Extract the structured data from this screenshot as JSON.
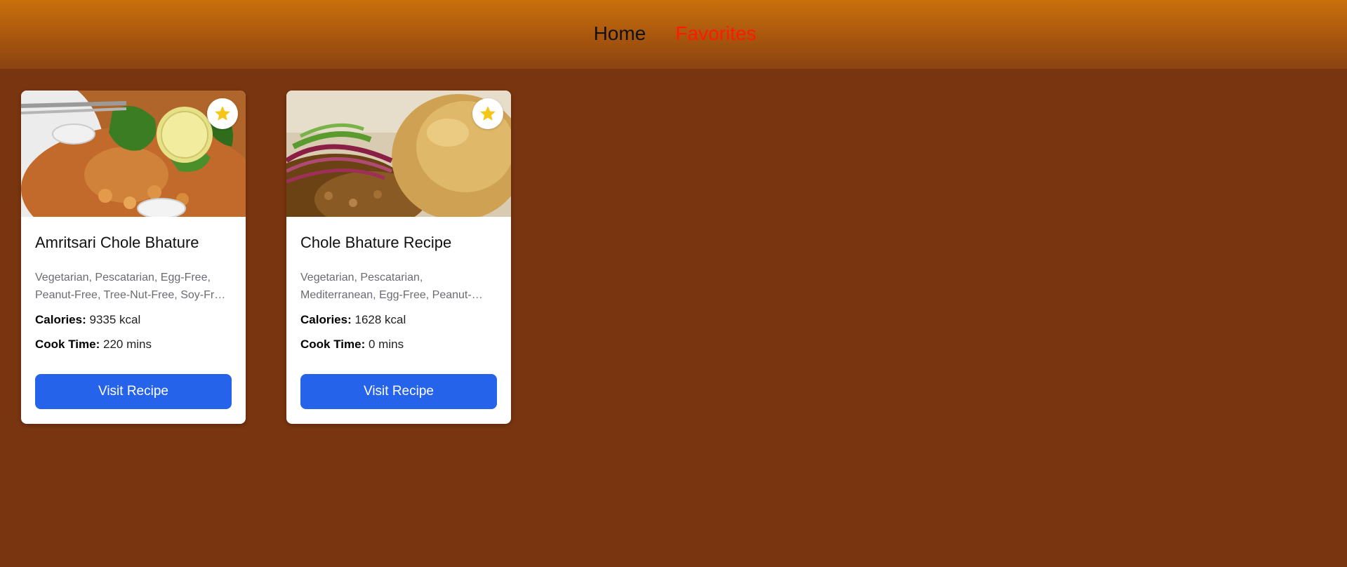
{
  "nav": {
    "home_label": "Home",
    "favorites_label": "Favorites",
    "active": "favorites"
  },
  "colors": {
    "background": "#783510",
    "button": "#2563eb",
    "active_link": "#ff1a00",
    "star": "#f5c518"
  },
  "recipes": [
    {
      "title": "Amritsari Chole Bhature",
      "tags": "Vegetarian, Pescatarian, Egg-Free, Peanut-Free, Tree-Nut-Free, Soy-Free, Fish-Free, Shellfish-Free, Pork-Free, Red-Meat-Free, Crustacean-Free, Celery-Free, Mustard-Free, Sesame-Free, Lupine-Free, Mollusk-Free, Alcohol-Free, Sulfite-Free",
      "calories_label": "Calories:",
      "calories_value": "9335 kcal",
      "cook_time_label": "Cook Time:",
      "cook_time_value": "220 mins",
      "button_label": "Visit Recipe",
      "favorite_icon": "star-icon",
      "image": "chole-with-lemon-and-cilantro"
    },
    {
      "title": "Chole Bhature Recipe",
      "tags": "Vegetarian, Pescatarian, Mediterranean, Egg-Free, Peanut-Free, Tree-Nut-Free, Soy-Free, Fish-Free, Shellfish-Free, Pork-Free, Red-Meat-Free, Crustacean-Free, Celery-Free, Mustard-Free, Sesame-Free, Lupine-Free, Mollusk-Free, Alcohol-Free",
      "calories_label": "Calories:",
      "calories_value": "1628 kcal",
      "cook_time_label": "Cook Time:",
      "cook_time_value": "0 mins",
      "button_label": "Visit Recipe",
      "favorite_icon": "star-icon",
      "image": "chole-with-bhatura-and-onion"
    }
  ]
}
